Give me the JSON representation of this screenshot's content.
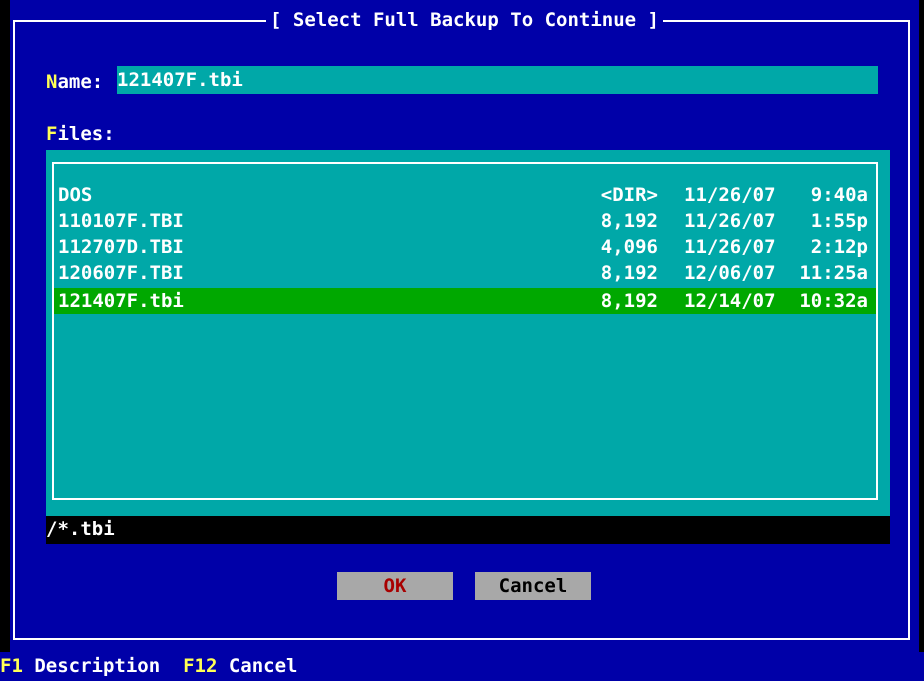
{
  "dialog": {
    "title": "[ Select Full Backup To Continue ]"
  },
  "name": {
    "hotkey": "N",
    "label_rest": "ame:",
    "value": "121407F.tbi"
  },
  "files": {
    "hotkey": "F",
    "label_rest": "iles:",
    "rows": [
      {
        "name": "DOS",
        "size": "<DIR>",
        "date": "11/26/07",
        "time": "9:40a"
      },
      {
        "name": "110107F.TBI",
        "size": "8,192",
        "date": "11/26/07",
        "time": "1:55p"
      },
      {
        "name": "112707D.TBI",
        "size": "4,096",
        "date": "11/26/07",
        "time": "2:12p"
      },
      {
        "name": "120607F.TBI",
        "size": "8,192",
        "date": "12/06/07",
        "time": "11:25a"
      },
      {
        "name": "121407F.tbi",
        "size": "8,192",
        "date": "12/14/07",
        "time": "10:32a"
      }
    ],
    "selected_index": 4
  },
  "filter": {
    "value": "/*.tbi"
  },
  "buttons": {
    "ok_label": "OK",
    "cancel_label": "Cancel"
  },
  "status_bar": {
    "f1_key": "F1",
    "f1_label": "Description",
    "f12_key": "F12",
    "f12_label": "Cancel"
  },
  "colors": {
    "dialog_bg": "#0000a8",
    "field_bg": "#00a8a8",
    "selected_bg": "#00a800",
    "hotkey": "#ffff55",
    "button_bg": "#a8a8a8",
    "ok_text": "#a80000"
  }
}
